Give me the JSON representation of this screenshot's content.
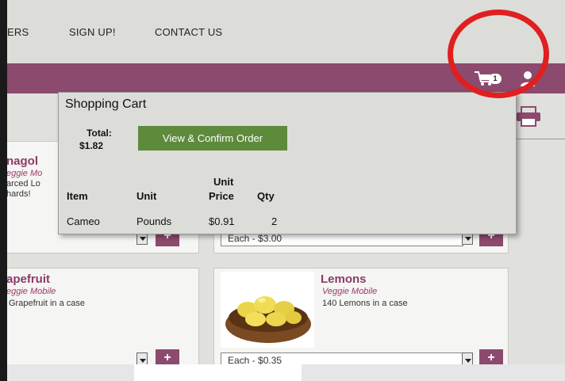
{
  "topnav": {
    "items": [
      {
        "label": "ERS"
      },
      {
        "label": "SIGN UP!"
      },
      {
        "label": "CONTACT US"
      }
    ]
  },
  "header": {
    "cart_count": "1"
  },
  "products": [
    {
      "title": "nagol",
      "vendor": "eggie Mo",
      "desc_line1": "arced Lo",
      "desc_line2": "hards!",
      "option": ""
    },
    {
      "title": "",
      "vendor": "",
      "desc_line1": "",
      "desc_line2": "",
      "option": "Each - $3.00"
    },
    {
      "title": "apefruit",
      "vendor": "eggie Mobile",
      "desc_line1": "Grapefruit in a case",
      "desc_line2": "",
      "option": ""
    },
    {
      "title": "Lemons",
      "vendor": "Veggie Mobile",
      "desc_line1": "140 Lemons in a case",
      "desc_line2": "",
      "option": "Each - $0.35"
    }
  ],
  "cart_popup": {
    "title": "Shopping Cart",
    "total_label": "Total:",
    "total_value": "$1.82",
    "confirm_label": "View & Confirm Order",
    "headers": {
      "item": "Item",
      "unit": "Unit",
      "price_top": "Unit",
      "price_bottom": "Price",
      "qty": "Qty"
    },
    "rows": [
      {
        "item": "Cameo",
        "unit": "Pounds",
        "price": "$0.91",
        "qty": "2"
      }
    ]
  },
  "colors": {
    "brand_purple": "#8c4a6e",
    "confirm_green": "#5e8a3c",
    "annotation_red": "#e01f1f"
  },
  "icons": [
    "cart-icon",
    "user-icon",
    "print-icon",
    "plus-icon",
    "chevron-down-icon"
  ]
}
